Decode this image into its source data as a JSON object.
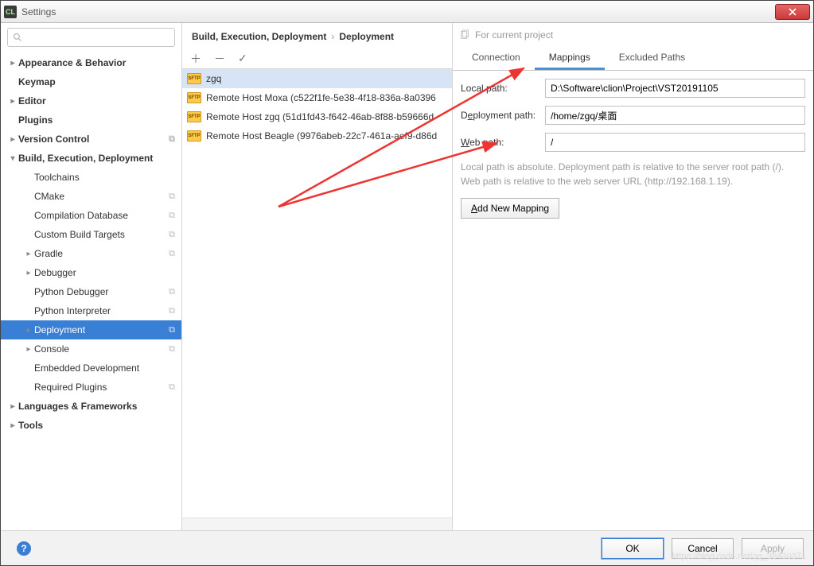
{
  "window": {
    "title": "Settings",
    "app_icon_text": "CL"
  },
  "search": {
    "placeholder": ""
  },
  "sidebar": {
    "items": [
      {
        "label": "Appearance & Behavior",
        "bold": true,
        "arrow": "right",
        "level": 1
      },
      {
        "label": "Keymap",
        "bold": true,
        "arrow": "",
        "level": 1
      },
      {
        "label": "Editor",
        "bold": true,
        "arrow": "right",
        "level": 1
      },
      {
        "label": "Plugins",
        "bold": true,
        "arrow": "",
        "level": 1
      },
      {
        "label": "Version Control",
        "bold": true,
        "arrow": "right",
        "level": 1,
        "copy": true
      },
      {
        "label": "Build, Execution, Deployment",
        "bold": true,
        "arrow": "down",
        "level": 1
      },
      {
        "label": "Toolchains",
        "bold": false,
        "arrow": "",
        "level": 2
      },
      {
        "label": "CMake",
        "bold": false,
        "arrow": "",
        "level": 2,
        "copy": true
      },
      {
        "label": "Compilation Database",
        "bold": false,
        "arrow": "",
        "level": 2,
        "copy": true
      },
      {
        "label": "Custom Build Targets",
        "bold": false,
        "arrow": "",
        "level": 2,
        "copy": true
      },
      {
        "label": "Gradle",
        "bold": false,
        "arrow": "right",
        "level": 2,
        "copy": true
      },
      {
        "label": "Debugger",
        "bold": false,
        "arrow": "right",
        "level": 2
      },
      {
        "label": "Python Debugger",
        "bold": false,
        "arrow": "",
        "level": 2,
        "copy": true
      },
      {
        "label": "Python Interpreter",
        "bold": false,
        "arrow": "",
        "level": 2,
        "copy": true
      },
      {
        "label": "Deployment",
        "bold": false,
        "arrow": "right",
        "level": 2,
        "copy": true,
        "selected": true
      },
      {
        "label": "Console",
        "bold": false,
        "arrow": "right",
        "level": 2,
        "copy": true
      },
      {
        "label": "Embedded Development",
        "bold": false,
        "arrow": "",
        "level": 2
      },
      {
        "label": "Required Plugins",
        "bold": false,
        "arrow": "",
        "level": 2,
        "copy": true
      },
      {
        "label": "Languages & Frameworks",
        "bold": true,
        "arrow": "right",
        "level": 1
      },
      {
        "label": "Tools",
        "bold": true,
        "arrow": "right",
        "level": 1
      }
    ]
  },
  "breadcrumb": {
    "root": "Build, Execution, Deployment",
    "leaf": "Deployment"
  },
  "mid_list": [
    {
      "label": "zgq",
      "selected": true
    },
    {
      "label": "Remote Host Moxa (c522f1fe-5e38-4f18-836a-8a0396"
    },
    {
      "label": "Remote Host zgq (51d1fd43-f642-46ab-8f88-b59666d"
    },
    {
      "label": "Remote Host Beagle (9976abeb-22c7-461a-aef9-d86d"
    }
  ],
  "right": {
    "project_hint": "For current project",
    "tabs": [
      {
        "label": "Connection"
      },
      {
        "label": "Mappings",
        "active": true
      },
      {
        "label": "Excluded Paths"
      }
    ],
    "local_path_label": "Local path:",
    "local_path_value": "D:\\Software\\clion\\Project\\VST20191105",
    "deploy_path_html": "D<span class='ul'>e</span>ployment path:",
    "deploy_path_value": "/home/zgq/桌面",
    "web_path_html": "<span class='ul'>W</span>eb path:",
    "web_path_value": "/",
    "hint": "Local path is absolute. Deployment path is relative to the server root path (/). Web path is relative to the web server URL (http://192.168.1.19).",
    "add_btn_html": "<span class='ul'>A</span>dd New Mapping"
  },
  "footer": {
    "ok": "OK",
    "cancel": "Cancel",
    "apply": "Apply"
  },
  "watermark": "https://blog.csdn.net/qq_38430371"
}
